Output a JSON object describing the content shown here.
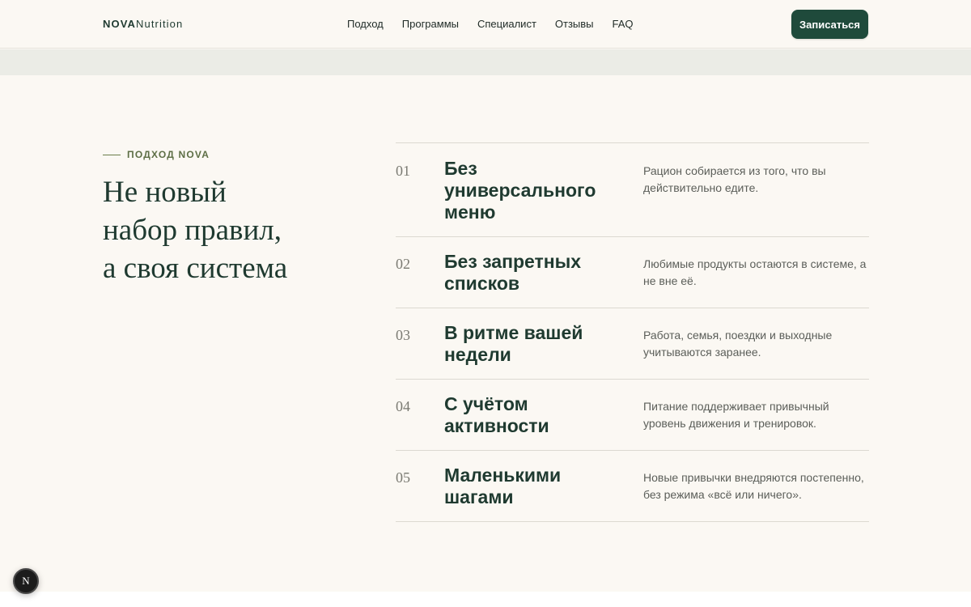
{
  "brand": {
    "logo_bold": "NOVA",
    "logo_light": "Nutrition",
    "accent": "#1f4a3b",
    "background": "#fbf8f3"
  },
  "nav": {
    "items": [
      {
        "label": "Подход",
        "name": "nav-approach"
      },
      {
        "label": "Программы",
        "name": "nav-programs"
      },
      {
        "label": "Специалист",
        "name": "nav-specialist"
      },
      {
        "label": "Отзывы",
        "name": "nav-reviews"
      },
      {
        "label": "FAQ",
        "name": "nav-faq"
      }
    ],
    "cta_label": "Записаться"
  },
  "section": {
    "eyebrow": "ПОДХОД NOVA",
    "heading": [
      "Не новый",
      "набор правил,",
      "а своя система"
    ]
  },
  "principles": [
    {
      "num": "01",
      "title": "Без универсального меню",
      "desc": "Рацион собирается из того, что вы действительно едите."
    },
    {
      "num": "02",
      "title": "Без запретных списков",
      "desc": "Любимые продукты остаются в системе, а не вне её."
    },
    {
      "num": "03",
      "title": "В ритме вашей недели",
      "desc": "Работа, семья, поездки и выходные учитываются заранее."
    },
    {
      "num": "04",
      "title": "С учётом активности",
      "desc": "Питание поддерживает привычный уровень движения и тренировок."
    },
    {
      "num": "05",
      "title": "Маленькими шагами",
      "desc": "Новые привычки внедряются постепенно, без режима «всё или ничего»."
    }
  ],
  "badge": {
    "letter": "N"
  }
}
